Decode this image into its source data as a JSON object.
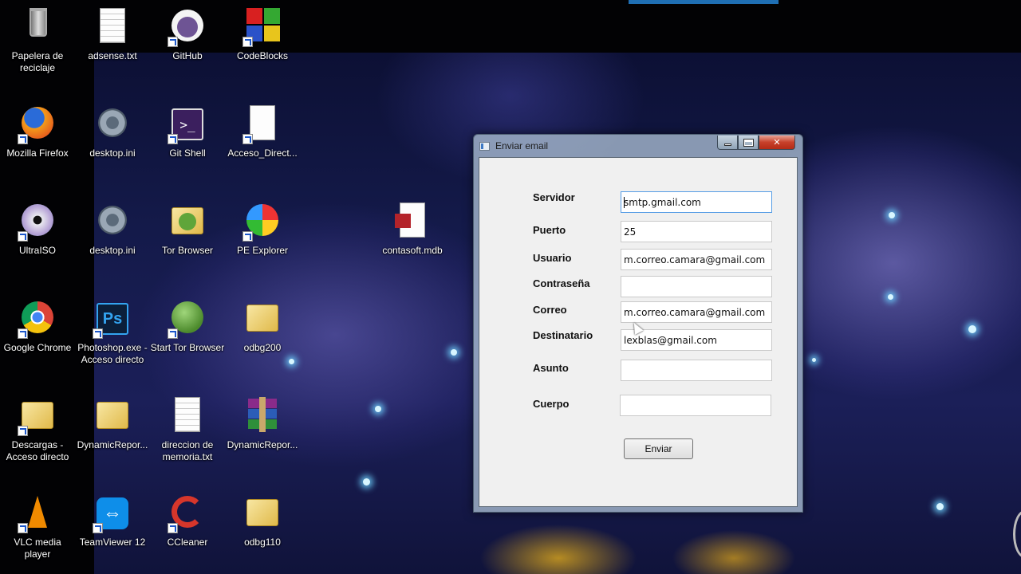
{
  "desktop": {
    "icons": [
      {
        "label": "Papelera de reciclaje",
        "icon": "recycle-bin-icon"
      },
      {
        "label": "adsense.txt",
        "icon": "text-file-icon"
      },
      {
        "label": "GitHub",
        "icon": "github-icon"
      },
      {
        "label": "CodeBlocks",
        "icon": "codeblocks-icon"
      },
      {
        "label": "Mozilla Firefox",
        "icon": "firefox-icon"
      },
      {
        "label": "desktop.ini",
        "icon": "settings-file-icon"
      },
      {
        "label": "Git Shell",
        "icon": "git-shell-icon"
      },
      {
        "label": "Acceso_Direct...",
        "icon": "shortcut-file-icon"
      },
      {
        "label": "UltraISO",
        "icon": "ultraiso-icon"
      },
      {
        "label": "desktop.ini",
        "icon": "settings-file-icon"
      },
      {
        "label": "Tor Browser",
        "icon": "tor-folder-icon"
      },
      {
        "label": "PE Explorer",
        "icon": "pe-explorer-icon"
      },
      {
        "label": "contasoft.mdb",
        "icon": "access-db-icon"
      },
      {
        "label": "Google Chrome",
        "icon": "chrome-icon"
      },
      {
        "label": "Photoshop.exe - Acceso directo",
        "icon": "photoshop-icon"
      },
      {
        "label": "Start Tor Browser",
        "icon": "tor-globe-icon"
      },
      {
        "label": "odbg200",
        "icon": "folder-icon"
      },
      {
        "label": "Descargas - Acceso directo",
        "icon": "downloads-folder-icon"
      },
      {
        "label": "DynamicRepor...",
        "icon": "folder-icon"
      },
      {
        "label": "direccion de memoria.txt",
        "icon": "text-file-icon"
      },
      {
        "label": "DynamicRepor...",
        "icon": "winrar-icon"
      },
      {
        "label": "VLC media player",
        "icon": "vlc-icon"
      },
      {
        "label": "TeamViewer 12",
        "icon": "teamviewer-icon"
      },
      {
        "label": "CCleaner",
        "icon": "ccleaner-icon"
      },
      {
        "label": "odbg110",
        "icon": "folder-icon"
      }
    ]
  },
  "window": {
    "title": "Enviar email",
    "controls": {
      "minimize": "minimize",
      "maximize": "maximize",
      "close": "close"
    }
  },
  "form": {
    "servidor_label": "Servidor",
    "servidor_value": "smtp.gmail.com",
    "puerto_label": "Puerto",
    "puerto_value": "25",
    "usuario_label": "Usuario",
    "usuario_value": "m.correo.camara@gmail.com",
    "contrasena_label": "Contraseña",
    "contrasena_value": "",
    "correo_label": "Correo",
    "correo_value": "m.correo.camara@gmail.com",
    "destinatario_label": "Destinatario",
    "destinatario_value": "lexblas@gmail.com",
    "asunto_label": "Asunto",
    "asunto_value": "",
    "cuerpo_label": "Cuerpo",
    "cuerpo_value": "",
    "send_label": "Enviar"
  },
  "colors": {
    "accent": "#1f6fb4",
    "close_button": "#c7402a",
    "window_bg": "#f0f0f0"
  }
}
